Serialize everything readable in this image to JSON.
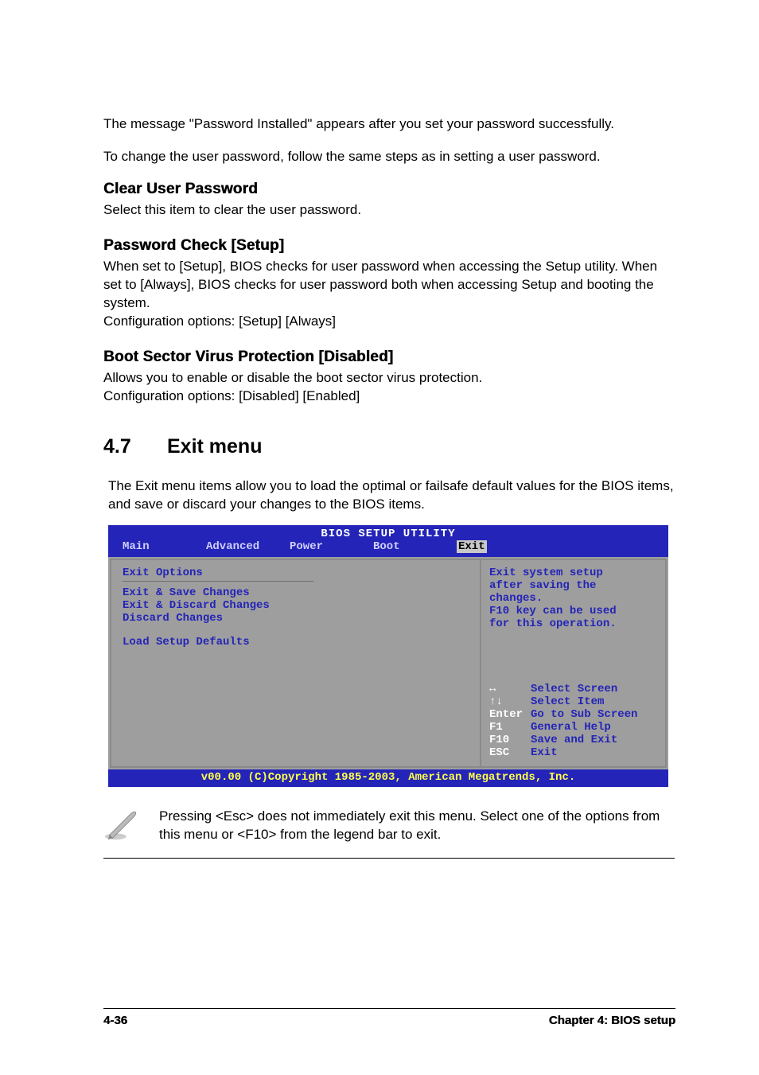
{
  "paragraphs": {
    "p1": "The message \"Password Installed\" appears after you set your password successfully.",
    "p2": "To change the user password, follow the same steps as in setting a user password."
  },
  "sections": {
    "clear_user_password": {
      "title": "Clear User Password",
      "body": "Select this item to clear the user password."
    },
    "password_check": {
      "title": "Password Check [Setup]",
      "body_l1": "When set to [Setup], BIOS checks for user password when accessing the Setup utility. When set to [Always], BIOS checks for user password both when accessing Setup and booting the system.",
      "body_l2": "Configuration options: [Setup] [Always]"
    },
    "boot_sector": {
      "title": "Boot Sector Virus Protection [Disabled]",
      "body_l1": "Allows you to enable or disable the boot sector virus protection.",
      "body_l2": "Configuration options: [Disabled] [Enabled]"
    }
  },
  "h2": {
    "num": "4.7",
    "title": "Exit menu"
  },
  "intro": "The Exit menu items allow you to load the optimal or failsafe default values for the BIOS items, and save or discard your changes to the BIOS items.",
  "bios": {
    "title": "BIOS SETUP UTILITY",
    "tabs": [
      "Main",
      "Advanced",
      "Power",
      "Boot",
      "Exit"
    ],
    "selected_tab": "Exit",
    "left_header": "Exit Options",
    "left_items": [
      "Exit & Save Changes",
      "Exit & Discard Changes",
      "Discard Changes",
      "",
      "Load Setup Defaults"
    ],
    "help_top": [
      "Exit system setup",
      "after saving the",
      "changes.",
      "F10 key can be used",
      "for this operation."
    ],
    "nav": [
      {
        "key": "↔",
        "label": "Select Screen"
      },
      {
        "key": "↑↓",
        "label": "Select Item"
      },
      {
        "key": "Enter",
        "label": "Go to Sub Screen"
      },
      {
        "key": "F1",
        "label": "General Help"
      },
      {
        "key": "F10",
        "label": "Save and Exit"
      },
      {
        "key": "ESC",
        "label": "Exit"
      }
    ],
    "footer": "v00.00 (C)Copyright 1985-2003, American Megatrends, Inc."
  },
  "note": "Pressing <Esc> does not immediately exit this menu. Select one of the options from this menu or <F10> from the legend bar to exit.",
  "page_footer": {
    "left": "4-36",
    "right": "Chapter 4: BIOS setup"
  }
}
